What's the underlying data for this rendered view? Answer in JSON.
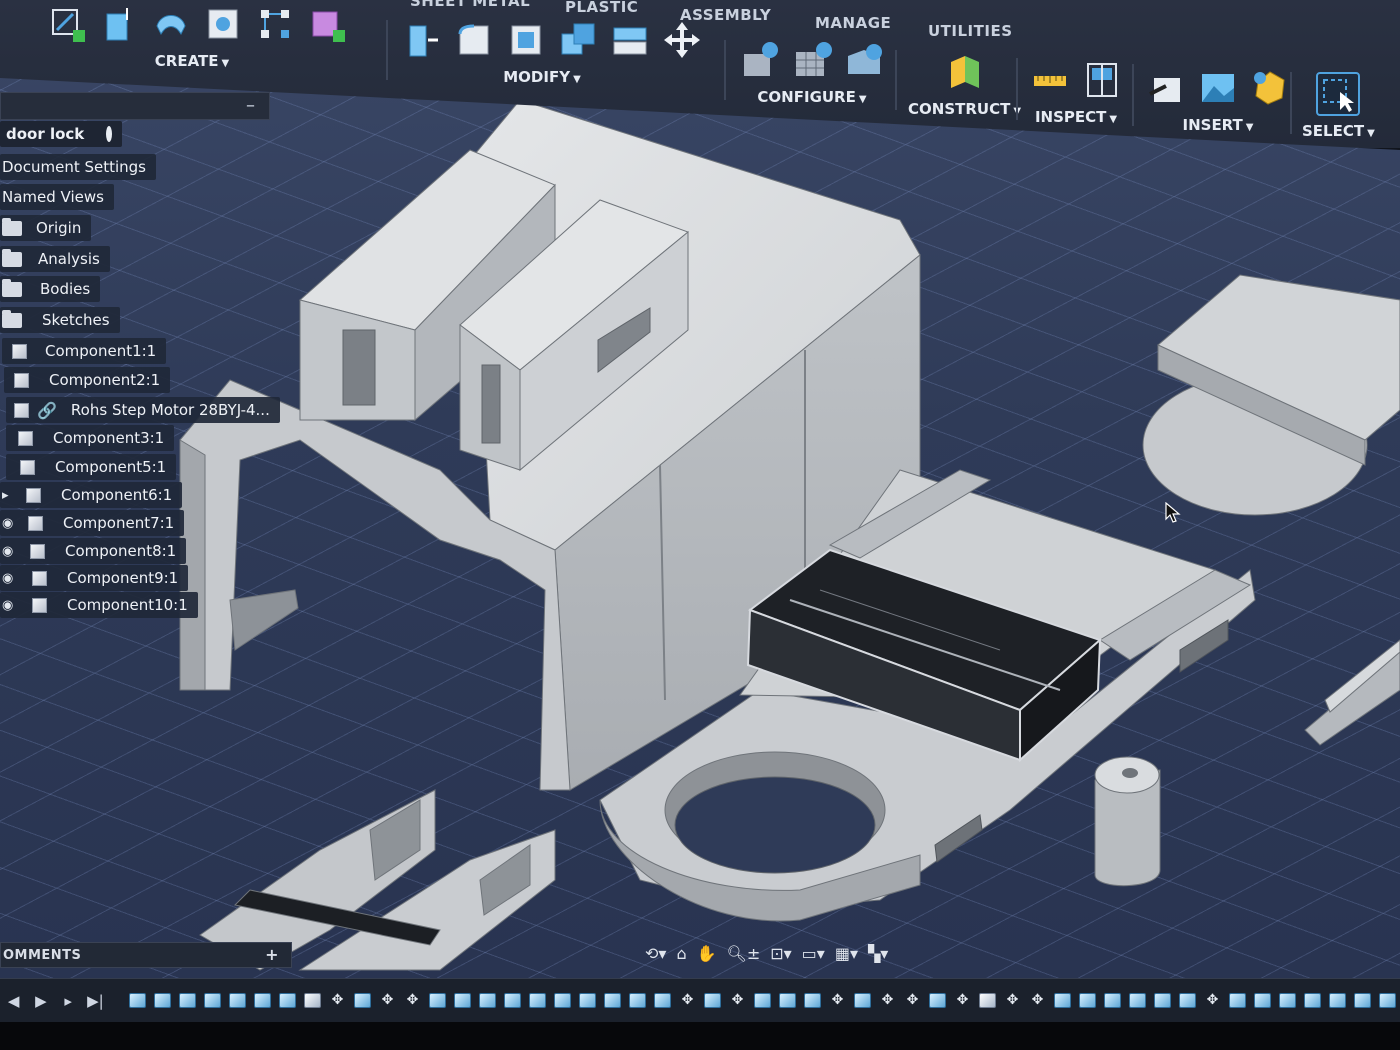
{
  "toolbar": {
    "tabs": [
      "SHEET METAL",
      "PLASTIC",
      "ASSEMBLY",
      "MANAGE",
      "UTILITIES"
    ],
    "groups": {
      "create": "CREATE",
      "modify": "MODIFY",
      "configure": "CONFIGURE",
      "construct": "CONSTRUCT",
      "inspect": "INSPECT",
      "insert": "INSERT",
      "select": "SELECT"
    }
  },
  "browser": {
    "root": "door lock",
    "items": [
      {
        "label": "Document Settings",
        "kind": "folder"
      },
      {
        "label": "Named Views",
        "kind": "folder"
      },
      {
        "label": "Origin",
        "kind": "folder"
      },
      {
        "label": "Analysis",
        "kind": "folder"
      },
      {
        "label": "Bodies",
        "kind": "folder"
      },
      {
        "label": "Sketches",
        "kind": "folder"
      },
      {
        "label": "Component1:1",
        "kind": "component"
      },
      {
        "label": "Component2:1",
        "kind": "component"
      },
      {
        "label": "Rohs Step Motor 28BYJ-4...",
        "kind": "linked"
      },
      {
        "label": "Component3:1",
        "kind": "component"
      },
      {
        "label": "Component5:1",
        "kind": "component"
      },
      {
        "label": "Component6:1",
        "kind": "component"
      },
      {
        "label": "Component7:1",
        "kind": "component"
      },
      {
        "label": "Component8:1",
        "kind": "component"
      },
      {
        "label": "Component9:1",
        "kind": "component"
      },
      {
        "label": "Component10:1",
        "kind": "component"
      }
    ]
  },
  "comments": {
    "label": "OMMENTS",
    "add": "+"
  },
  "icons": {
    "nav": [
      "orbit-icon",
      "look-at-icon",
      "pan-icon",
      "zoom-icon",
      "fit-icon",
      "display-settings-icon",
      "grid-icon",
      "viewports-icon"
    ]
  },
  "colors": {
    "accent": "#4fa3e0",
    "panel": "#232a39",
    "viewport": "#2f3b58",
    "body": "#c9ccd0"
  }
}
